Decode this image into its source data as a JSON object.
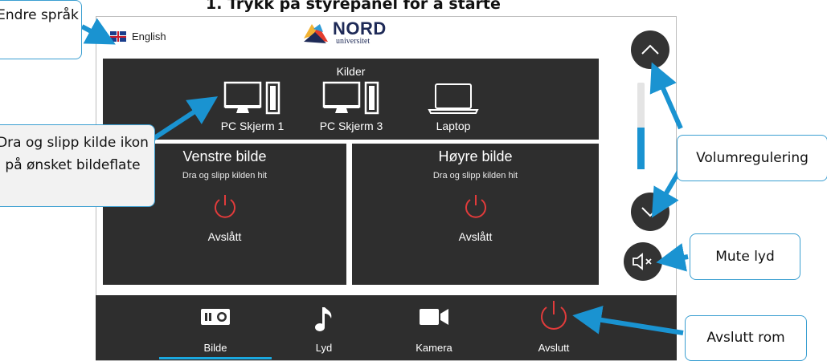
{
  "heading": "1.   Trykk på styrepanel for å starte",
  "language": {
    "label": "English"
  },
  "logo": {
    "name": "NORD",
    "sub": "universitet"
  },
  "sources": {
    "title": "Kilder",
    "items": [
      {
        "label": "PC Skjerm 1",
        "icon": "monitor-icon"
      },
      {
        "label": "PC Skjerm 3",
        "icon": "monitor-icon"
      },
      {
        "label": "Laptop",
        "icon": "laptop-icon"
      }
    ]
  },
  "image_panels": [
    {
      "title": "Venstre bilde",
      "hint": "Dra og slipp kilden hit",
      "status": "Avslått"
    },
    {
      "title": "Høyre bilde",
      "hint": "Dra og slipp kilden hit",
      "status": "Avslått"
    }
  ],
  "volume": {
    "level_fraction": 0.48
  },
  "bottom_nav": {
    "items": [
      {
        "label": "Bilde",
        "icon": "projector-icon"
      },
      {
        "label": "Lyd",
        "icon": "music-note-icon"
      },
      {
        "label": "Kamera",
        "icon": "camera-icon"
      },
      {
        "label": "Avslutt",
        "icon": "power-icon"
      }
    ],
    "active": "Bilde"
  },
  "callouts": {
    "language": "Endre språk",
    "drag": "Dra og slipp kilde ikon på ønsket bildeflate",
    "volume": "Volumregulering",
    "mute": "Mute lyd",
    "end": "Avslutt rom"
  },
  "colors": {
    "panel": "#2e2e2e",
    "accent": "#1a93d1",
    "power": "#e23b3b",
    "callout_border": "#3b9fd1"
  }
}
